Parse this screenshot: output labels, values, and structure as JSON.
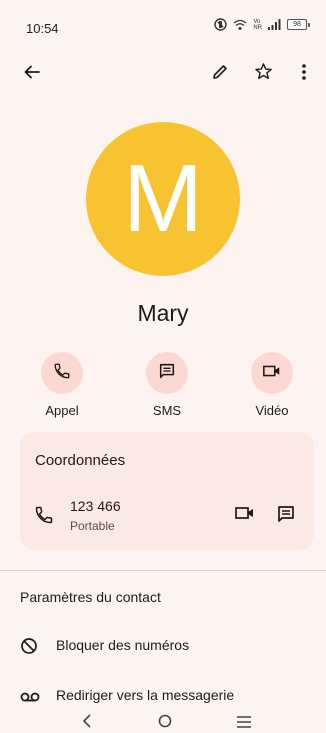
{
  "status_bar": {
    "time": "10:54",
    "network_label_top": "Vo",
    "network_label_bottom": "NR",
    "battery": "98"
  },
  "toolbar": {
    "back_icon": "arrow-back-icon",
    "edit_icon": "pencil-icon",
    "favorite_icon": "star-outline-icon",
    "more_icon": "more-vert-icon"
  },
  "contact": {
    "initial": "M",
    "name": "Mary",
    "avatar_color": "#f8c331"
  },
  "actions": [
    {
      "label": "Appel",
      "icon": "phone-icon"
    },
    {
      "label": "SMS",
      "icon": "message-icon"
    },
    {
      "label": "Vidéo",
      "icon": "video-icon"
    }
  ],
  "details": {
    "title": "Coordonnées",
    "phone": {
      "number": "123 466",
      "type": "Portable"
    }
  },
  "settings": {
    "title": "Paramètres du contact",
    "items": [
      {
        "label": "Bloquer des numéros",
        "icon": "block-icon"
      },
      {
        "label": "Rediriger vers la messagerie",
        "icon": "voicemail-icon"
      }
    ]
  },
  "colors": {
    "background": "#fdf4f1",
    "action_circle": "#fbd9d2",
    "card": "#fbe9e4",
    "accent": "#8c1d18"
  }
}
